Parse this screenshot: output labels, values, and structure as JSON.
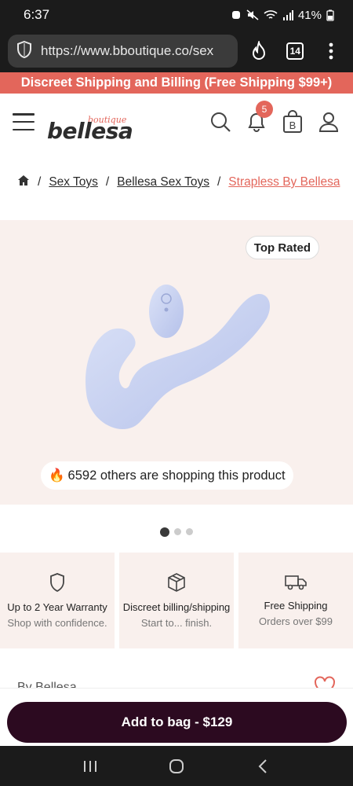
{
  "status_bar": {
    "time": "6:37",
    "battery": "41%"
  },
  "browser": {
    "url": "https://www.bboutique.co/sex",
    "tab_count": "14"
  },
  "promo": {
    "text": "Discreet Shipping and Billing (Free Shipping $99+)"
  },
  "header": {
    "logo": "bellesa",
    "logo_sub": "boutique",
    "notification_count": "5",
    "bag_letter": "B"
  },
  "breadcrumb": {
    "separator": "/",
    "items": [
      "Sex Toys",
      "Bellesa Sex Toys",
      "Strapless By Bellesa"
    ]
  },
  "product": {
    "badge": "Top Rated",
    "shoppers_emoji": "🔥",
    "shoppers_text": "6592 others are shopping this product",
    "image_color": "#c9d3f1"
  },
  "carousel": {
    "total": 3,
    "active": 0
  },
  "features": [
    {
      "icon": "shield-icon",
      "title": "Up to 2 Year Warranty",
      "subtitle": "Shop with confidence."
    },
    {
      "icon": "box-icon",
      "title": "Discreet billing/shipping",
      "subtitle": "Start to... finish."
    },
    {
      "icon": "truck-icon",
      "title": "Free Shipping",
      "subtitle": "Orders over $99"
    }
  ],
  "brand": {
    "text": "By Bellesa"
  },
  "cta": {
    "label": "Add to bag -  $129"
  },
  "colors": {
    "accent": "#e3665b",
    "cta_bg": "#2c0a20",
    "panel_bg": "#f9f0ed"
  }
}
